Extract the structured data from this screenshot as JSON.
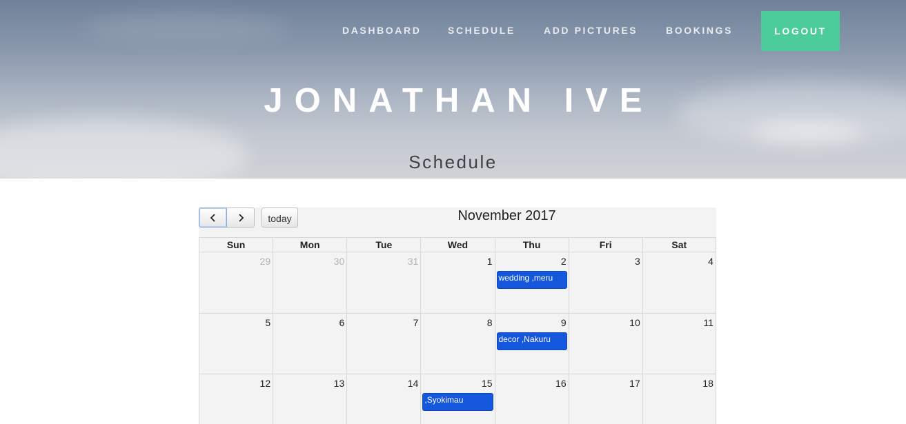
{
  "nav": {
    "items": [
      {
        "label": "DASHBOARD"
      },
      {
        "label": "SCHEDULE"
      },
      {
        "label": "ADD PICTURES"
      },
      {
        "label": "BOOKINGS"
      }
    ],
    "logout_label": "LOGOUT",
    "logout_color": "#4ccc9b"
  },
  "hero": {
    "title": "JONATHAN IVE",
    "subtitle": "Schedule"
  },
  "calendar": {
    "prev_icon": "chevron-left-icon",
    "next_icon": "chevron-right-icon",
    "today_label": "today",
    "month_title": "November 2017",
    "event_color": "#1457dd",
    "weekdays": [
      "Sun",
      "Mon",
      "Tue",
      "Wed",
      "Thu",
      "Fri",
      "Sat"
    ],
    "weeks": [
      [
        {
          "day": "29",
          "other": true
        },
        {
          "day": "30",
          "other": true
        },
        {
          "day": "31",
          "other": true
        },
        {
          "day": "1"
        },
        {
          "day": "2",
          "event": "wedding ,meru"
        },
        {
          "day": "3"
        },
        {
          "day": "4"
        }
      ],
      [
        {
          "day": "5"
        },
        {
          "day": "6"
        },
        {
          "day": "7"
        },
        {
          "day": "8"
        },
        {
          "day": "9",
          "event": "decor ,Nakuru"
        },
        {
          "day": "10"
        },
        {
          "day": "11"
        }
      ],
      [
        {
          "day": "12"
        },
        {
          "day": "13"
        },
        {
          "day": "14"
        },
        {
          "day": "15",
          "event": ",Syokimau"
        },
        {
          "day": "16"
        },
        {
          "day": "17"
        },
        {
          "day": "18"
        }
      ]
    ]
  }
}
